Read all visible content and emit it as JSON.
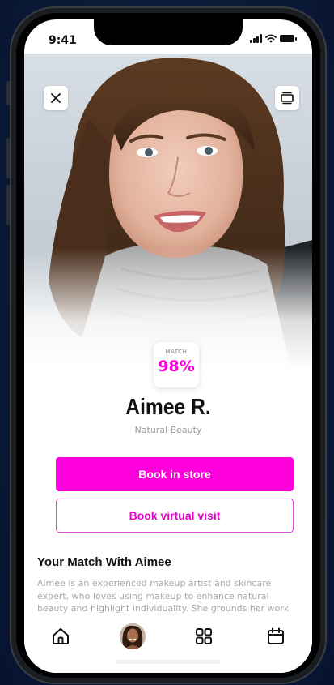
{
  "status_bar": {
    "time": "9:41"
  },
  "profile": {
    "match_label": "MATCH",
    "match_value": "98%",
    "name": "Aimee R.",
    "subtitle": "Natural Beauty"
  },
  "actions": {
    "book_store_label": "Book in store",
    "book_virtual_label": "Book virtual visit"
  },
  "about": {
    "title": "Your Match With Aimee",
    "body": "Aimee is an experienced makeup artist and skincare expert, who loves using makeup to enhance natural beauty and highlight individuality. She grounds her work"
  },
  "tabs": [
    {
      "icon": "home-icon"
    },
    {
      "icon": "avatar"
    },
    {
      "icon": "grid-icon"
    },
    {
      "icon": "calendar-icon"
    }
  ],
  "colors": {
    "accent": "#ff00dd",
    "text_primary": "#111111",
    "text_secondary": "#9a9a9a"
  }
}
